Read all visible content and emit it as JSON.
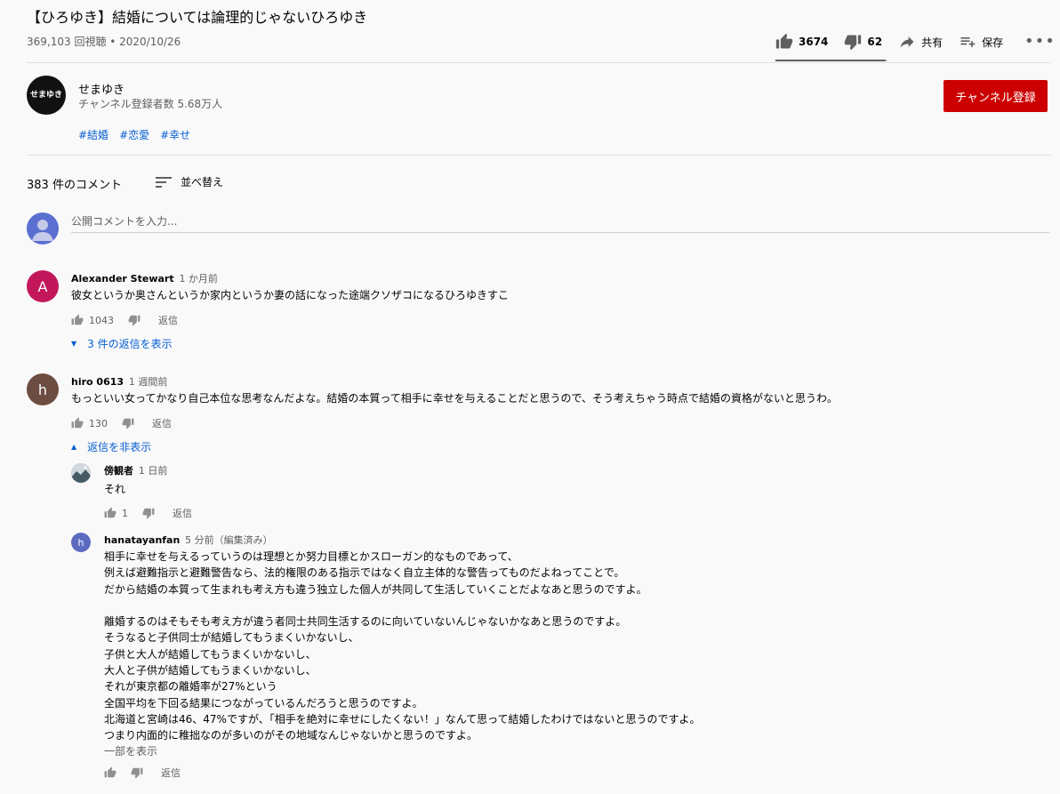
{
  "video": {
    "title": "【ひろゆき】結婚については論理的じゃないひろゆき",
    "meta": "369,103 回視聴 • 2020/10/26",
    "likes": "3674",
    "dislikes": "62",
    "share": "共有",
    "save": "保存",
    "more": "•••",
    "like_ratio": 0.98
  },
  "channel": {
    "avatar_text": "せまゆき",
    "name": "せまゆき",
    "subscribers": "チャンネル登録者数 5.68万人",
    "subscribe_label": "チャンネル登録",
    "tags": [
      "#結婚",
      "#恋愛",
      "#幸せ"
    ]
  },
  "comments_header": {
    "count": "383 件のコメント",
    "sort_label": "並べ替え",
    "input_placeholder": "公開コメントを入力..."
  },
  "comments": [
    {
      "avatar_letter": "A",
      "avatar_color": "#c2185b",
      "author": "Alexander Stewart",
      "time": "1 か月前",
      "text": "彼女というか奥さんというか家内というか妻の話になった途端クソザコになるひろゆきすこ",
      "likes": "1043",
      "reply_label": "返信",
      "toggle_label": "3 件の返信を表示"
    },
    {
      "avatar_letter": "h",
      "avatar_color": "#6d4c41",
      "author": "hiro 0613",
      "time": "1 週間前",
      "text": "もっといい女ってかなり自己本位な思考なんだよな。結婚の本質って相手に幸せを与えることだと思うので、そう考えちゃう時点で結婚の資格がないと思うわ。",
      "likes": "130",
      "reply_label": "返信",
      "toggle_label": "返信を非表示"
    }
  ],
  "replies": [
    {
      "author": "傍観者",
      "time": "1 日前",
      "text": "それ",
      "likes": "1",
      "reply_label": "返信"
    },
    {
      "avatar_letter": "h",
      "avatar_color": "#5c6bc0",
      "author": "hanatayanfan",
      "time": "5 分前（編集済み）",
      "text": "相手に幸せを与えるっていうのは理想とか努力目標とかスローガン的なものであって、\n例えば避難指示と避難警告なら、法的権限のある指示ではなく自立主体的な警告ってものだよねってことで。\nだから結婚の本質って生まれも考え方も違う独立した個人が共同して生活していくことだよなあと思うのですよ。\n\n離婚するのはそもそも考え方が違う者同士共同生活するのに向いていないんじゃないかなあと思うのですよ。\nそうなると子供同士が結婚してもうまくいかないし、\n子供と大人が結婚してもうまくいかないし、\n大人と子供が結婚してもうまくいかないし、\nそれが東京都の離婚率が27%という\n全国平均を下回る結果につながっているんだろうと思うのですよ。\n北海道と宮崎は46、47%ですが、「相手を絶対に幸せにしたくない！」なんて思って結婚したわけではないと思うのですよ。\nつまり内面的に稚拙なのが多いのがその地域なんじゃないかと思うのですよ。",
      "show_more": "一部を表示",
      "reply_label": "返信"
    }
  ],
  "colors": {
    "background": "#f9f9f9",
    "subscribe": "#cc0000",
    "link": "#065fd4",
    "secondary_text": "#606060"
  },
  "icons": [
    "thumb-up-icon",
    "thumb-down-icon",
    "share-icon",
    "save-icon",
    "more-icon",
    "sort-icon",
    "user-avatar-icon",
    "caret-icon"
  ]
}
